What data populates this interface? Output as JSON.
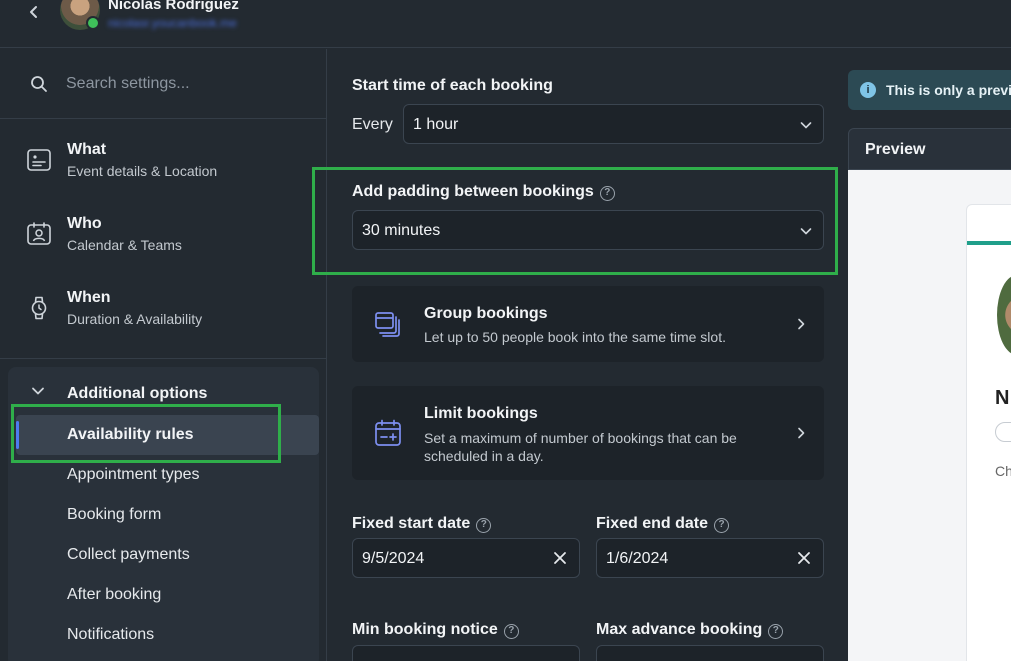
{
  "header": {
    "user_name": "Nicolas Rodriguez",
    "user_email": "nicolasr.youcanbook.me"
  },
  "sidebar": {
    "search_placeholder": "Search settings...",
    "nav": [
      {
        "title": "What",
        "subtitle": "Event details & Location"
      },
      {
        "title": "Who",
        "subtitle": "Calendar & Teams"
      },
      {
        "title": "When",
        "subtitle": "Duration & Availability"
      }
    ],
    "additional_options": {
      "title": "Additional options",
      "items": [
        "Availability rules",
        "Appointment types",
        "Booking form",
        "Collect payments",
        "After booking",
        "Notifications"
      ],
      "active_index": 0
    }
  },
  "main": {
    "start_time": {
      "label": "Start time of each booking",
      "prefix": "Every",
      "value": "1 hour"
    },
    "padding": {
      "label": "Add padding between bookings",
      "value": "30 minutes"
    },
    "group_bookings": {
      "title": "Group bookings",
      "description": "Let up to 50 people book into the same time slot."
    },
    "limit_bookings": {
      "title": "Limit bookings",
      "description": "Set a maximum of number of bookings that can be scheduled in a day."
    },
    "fixed_start": {
      "label": "Fixed start date",
      "value": "9/5/2024"
    },
    "fixed_end": {
      "label": "Fixed end date",
      "value": "1/6/2024"
    },
    "min_notice": {
      "label": "Min booking notice"
    },
    "max_advance": {
      "label": "Max advance booking"
    }
  },
  "preview": {
    "notice": "This is only a previ",
    "title": "Preview",
    "initial": "N",
    "text": "Ch"
  },
  "colors": {
    "background": "#232a31",
    "highlight": "#2fae4a",
    "accent": "#4d7cf0"
  }
}
